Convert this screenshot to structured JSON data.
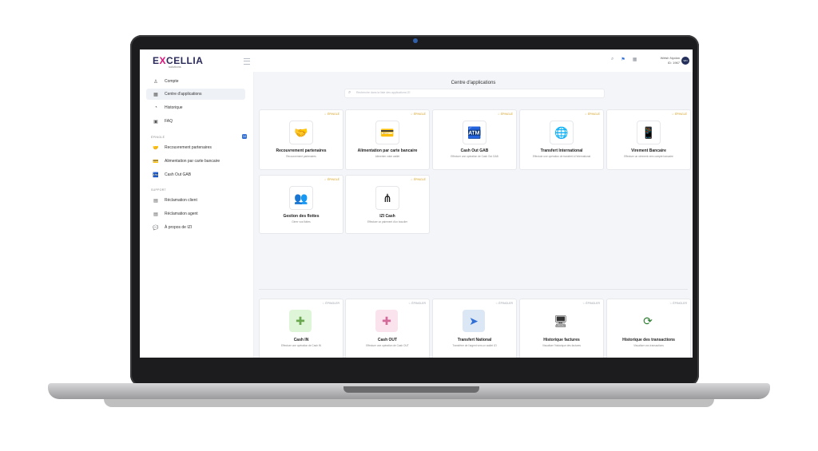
{
  "app": {
    "logo_main": "E CELLIA",
    "logo_x": "X",
    "logo_pre": "E",
    "logo_post": "CELLIA",
    "logo_sub": "solutions",
    "user_name": "Welsh Nyclan",
    "user_role": "ID: 1967",
    "avatar_initials": "WN"
  },
  "sidebar": {
    "items": [
      {
        "label": "Compte",
        "icon": "user-icon"
      },
      {
        "label": "Centre d'applications",
        "icon": "apps-icon"
      },
      {
        "label": "Historique",
        "icon": "history-icon"
      },
      {
        "label": "FAQ",
        "icon": "faq-icon"
      }
    ],
    "section_epingle": "ÉPINGLÉ",
    "badge": "14",
    "pinned": [
      {
        "label": "Recouvrement partenaires",
        "icon": "handshake-icon"
      },
      {
        "label": "Alimentation par carte bancaire",
        "icon": "card-icon"
      },
      {
        "label": "Cash Out GAB",
        "icon": "atm-icon"
      }
    ],
    "section_support": "SUPPORT",
    "support": [
      {
        "label": "Réclamation client",
        "icon": "complaint-icon"
      },
      {
        "label": "Réclamation agent",
        "icon": "complaint-agent-icon"
      },
      {
        "label": "À propos de IZI",
        "icon": "info-icon"
      }
    ]
  },
  "main": {
    "title": "Centre d'applications",
    "search_placeholder": "Recherche dans la liste des applications IZI",
    "pinned_label": "ÉPINGLÉ",
    "pin_label": "ÉPINGLER",
    "pinned_cards": [
      {
        "name": "Recouvrement partenaires",
        "desc": "Recouvrement partenaires",
        "icon": "handshake-icon"
      },
      {
        "name": "Alimentation par carte bancaire",
        "desc": "Alimenter votre wallet",
        "icon": "card-icon"
      },
      {
        "name": "Cash Out GAB",
        "desc": "Effectuer une opération de Cash Out GAB",
        "icon": "atm-icon"
      },
      {
        "name": "Transfert International",
        "desc": "Effectuer une opération de transfert à l'international",
        "icon": "globe-icon"
      },
      {
        "name": "Virement Bancaire",
        "desc": "Effectuer un virement vers compte bancaire",
        "icon": "bank-phone-icon"
      },
      {
        "name": "Gestion des flottes",
        "desc": "Gérer vos flottes",
        "icon": "fleet-icon"
      },
      {
        "name": "IZI Cash",
        "desc": "Effectuer un paiement d'un bouclier",
        "icon": "tree-icon"
      }
    ],
    "other_cards": [
      {
        "name": "Cash IN",
        "desc": "Effectuer une opération de Cash IN",
        "icon": "cash-in-icon",
        "bg": "#dff5d8"
      },
      {
        "name": "Cash OUT",
        "desc": "Effectuer une opération de Cash OUT",
        "icon": "cash-out-icon",
        "bg": "#fbe3ee"
      },
      {
        "name": "Transfert National",
        "desc": "Transférer de l'argent vers un wallet IZI",
        "icon": "send-icon",
        "bg": "#dbe7f5"
      },
      {
        "name": "Historique factures",
        "desc": "Visualiser l'historique des factures",
        "icon": "monitor-icon",
        "bg": "#ffffff"
      },
      {
        "name": "Historique des transactions",
        "desc": "Visualiser vos transactions",
        "icon": "transactions-icon",
        "bg": "#ffffff"
      }
    ]
  },
  "colors": {
    "accent": "#2f6fd6",
    "pinned_star": "#d4a020",
    "brand": "#e0127b"
  }
}
